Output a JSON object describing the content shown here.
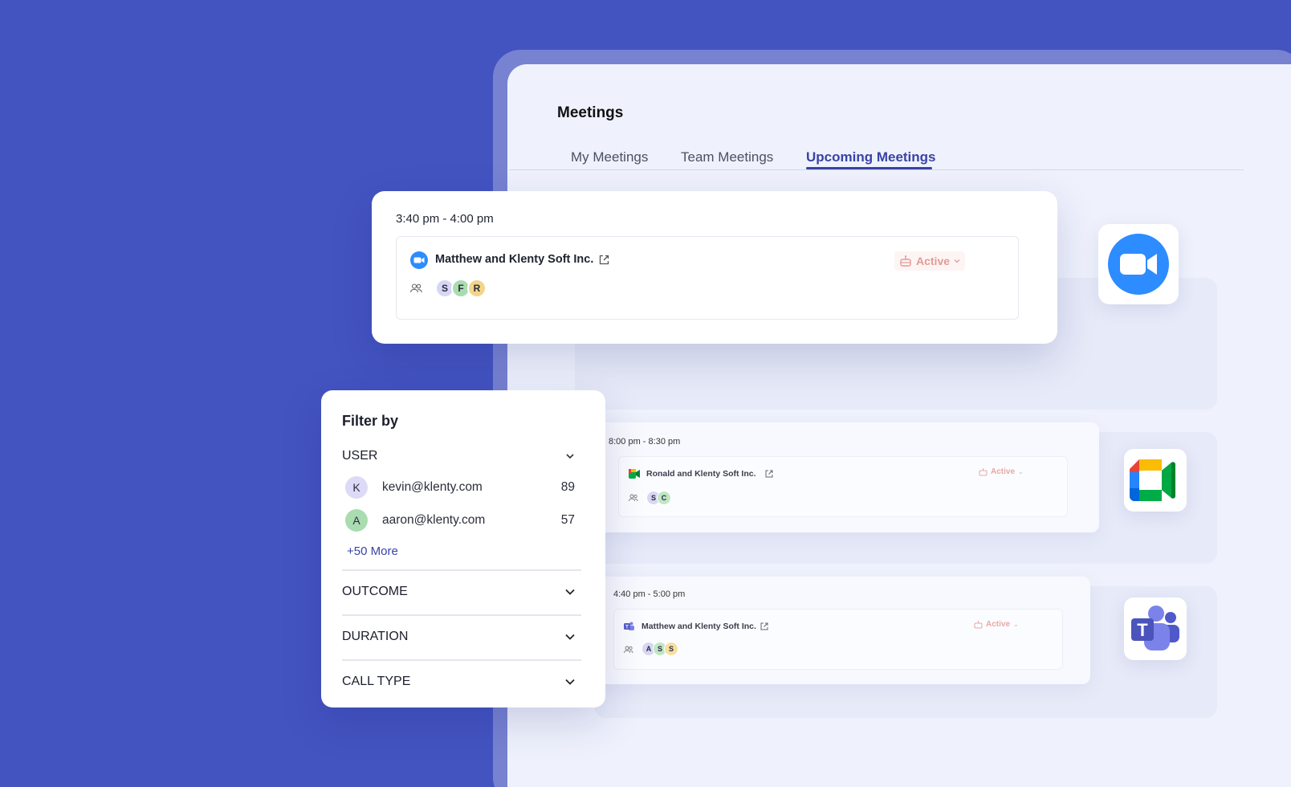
{
  "page": {
    "title": "Meetings"
  },
  "tabs": [
    {
      "label": "My Meetings",
      "active": false
    },
    {
      "label": "Team Meetings",
      "active": false
    },
    {
      "label": "Upcoming Meetings",
      "active": true
    }
  ],
  "featured_meeting": {
    "time": "3:40 pm - 4:00 pm",
    "title": "Matthew and Klenty Soft Inc.",
    "platform_icon": "zoom-icon",
    "status": "Active",
    "attendees": [
      "S",
      "F",
      "R"
    ]
  },
  "meetings": [
    {
      "time": "8:00 pm - 8:30 pm",
      "title": "Ronald and Klenty Soft Inc.",
      "platform_icon": "google-meet-icon",
      "status": "Active",
      "attendees": [
        "S",
        "C"
      ]
    },
    {
      "time": "4:40 pm - 5:00 pm",
      "title": "Matthew and Klenty Soft Inc.",
      "platform_icon": "teams-icon",
      "status": "Active",
      "attendees": [
        "A",
        "S",
        "S"
      ]
    }
  ],
  "filter": {
    "title": "Filter by",
    "sections": {
      "user": "USER",
      "outcome": "OUTCOME",
      "duration": "DURATION",
      "call_type": "CALL TYPE"
    },
    "users": [
      {
        "initial": "K",
        "email": "kevin@klenty.com",
        "count": "89"
      },
      {
        "initial": "A",
        "email": "aaron@klenty.com",
        "count": "57"
      }
    ],
    "more": "+50 More"
  },
  "colors": {
    "background": "#4353c0",
    "accent": "#3a43a6",
    "status_active": "#e39a96",
    "zoom_blue": "#2d8cff",
    "teams_purple": "#5b5fc7"
  }
}
